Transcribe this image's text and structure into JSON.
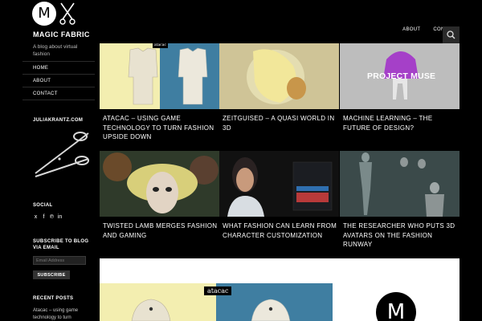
{
  "site": {
    "logo_letter": "M",
    "title": "MAGIC FABRIC",
    "description": "A blog about virtual fashion"
  },
  "sidebar": {
    "nav": [
      {
        "label": "HOME"
      },
      {
        "label": "ABOUT"
      },
      {
        "label": "CONTACT"
      }
    ],
    "image_widget_title": "JULIAKRANTZ.COM",
    "social_title": "SOCIAL",
    "social_icons": [
      "twitter-icon",
      "facebook-icon",
      "pinterest-icon",
      "linkedin-icon"
    ],
    "subscribe_title": "SUBSCRIBE TO BLOG VIA EMAIL",
    "email_placeholder": "Email Address",
    "subscribe_label": "SUBSCRIBE",
    "recent_title": "RECENT POSTS",
    "recent_post": "Atacac – using game technology to turn"
  },
  "header": {
    "nav": [
      {
        "label": "ABOUT"
      },
      {
        "label": "CONTACT"
      }
    ]
  },
  "posts": [
    {
      "title": "ATACAC – USING GAME TECHNOLOGY TO TURN FASHION UPSIDE DOWN",
      "tag": "atacac"
    },
    {
      "title": "ZEITGUISED – A QUASI WORLD IN 3D"
    },
    {
      "title": "MACHINE LEARNING – THE FUTURE OF DESIGN?",
      "overlay": "PROJECT MUSE"
    },
    {
      "title": "TWISTED LAMB MERGES FASHION AND GAMING"
    },
    {
      "title": "WHAT FASHION CAN LEARN FROM CHARACTER CUSTOMIZATION"
    },
    {
      "title": "THE RESEARCHER WHO PUTS 3D AVATARS ON THE FASHION RUNWAY"
    }
  ],
  "featured": {
    "tag": "atacac",
    "logo_letter": "M"
  }
}
